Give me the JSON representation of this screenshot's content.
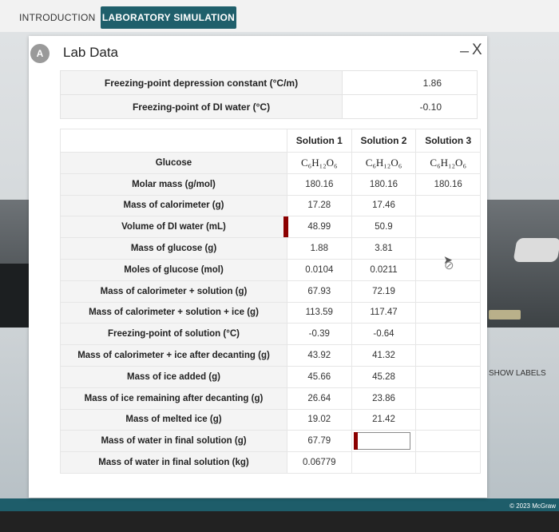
{
  "tabs": {
    "intro": "INTRODUCTION",
    "lab": "LABORATORY SIMULATION"
  },
  "panel": {
    "badge": "A",
    "title": "Lab Data",
    "minimize": "–",
    "close": "X"
  },
  "constants": [
    {
      "label": "Freezing-point depression constant (°C/m)",
      "value": "1.86"
    },
    {
      "label": "Freezing-point of DI water (°C)",
      "value": "-0.10"
    }
  ],
  "table": {
    "headers": [
      "Solution 1",
      "Solution 2",
      "Solution 3"
    ],
    "rows": [
      {
        "label": "Glucose",
        "s1": "C₆H₁₂O₆",
        "s2": "C₆H₁₂O₆",
        "s3": "C₆H₁₂O₆"
      },
      {
        "label": "Molar mass (g/mol)",
        "s1": "180.16",
        "s2": "180.16",
        "s3": "180.16"
      },
      {
        "label": "Mass of calorimeter (g)",
        "s1": "17.28",
        "s2": "17.46",
        "s3": ""
      },
      {
        "label": "Volume of DI water (mL)",
        "s1": "48.99",
        "s2": "50.9",
        "s3": ""
      },
      {
        "label": "Mass of glucose (g)",
        "s1": "1.88",
        "s2": "3.81",
        "s3": ""
      },
      {
        "label": "Moles of glucose (mol)",
        "s1": "0.0104",
        "s2": "0.0211",
        "s3": ""
      },
      {
        "label": "Mass of calorimeter + solution (g)",
        "s1": "67.93",
        "s2": "72.19",
        "s3": ""
      },
      {
        "label": "Mass of calorimeter + solution + ice (g)",
        "s1": "113.59",
        "s2": "117.47",
        "s3": ""
      },
      {
        "label": "Freezing-point of solution (°C)",
        "s1": "-0.39",
        "s2": "-0.64",
        "s3": ""
      },
      {
        "label": "Mass of calorimeter + ice after decanting (g)",
        "s1": "43.92",
        "s2": "41.32",
        "s3": ""
      },
      {
        "label": "Mass of ice added (g)",
        "s1": "45.66",
        "s2": "45.28",
        "s3": ""
      },
      {
        "label": "Mass of ice remaining after decanting (g)",
        "s1": "26.64",
        "s2": "23.86",
        "s3": ""
      },
      {
        "label": "Mass of melted ice (g)",
        "s1": "19.02",
        "s2": "21.42",
        "s3": ""
      },
      {
        "label": "Mass of water in final solution (g)",
        "s1": "67.79",
        "s2": "",
        "s3": ""
      },
      {
        "label": "Mass of water in final solution (kg)",
        "s1": "0.06779",
        "s2": "",
        "s3": ""
      }
    ]
  },
  "side": {
    "show_labels": "SHOW LABELS"
  },
  "footer": {
    "copyright": "© 2023 McGraw"
  },
  "colors": {
    "accent": "#1f5f6b",
    "marker": "#8b0000"
  },
  "icons": [
    "flask-icon",
    "close-icon",
    "minimize-icon",
    "cursor-icon",
    "not-allowed-icon"
  ]
}
